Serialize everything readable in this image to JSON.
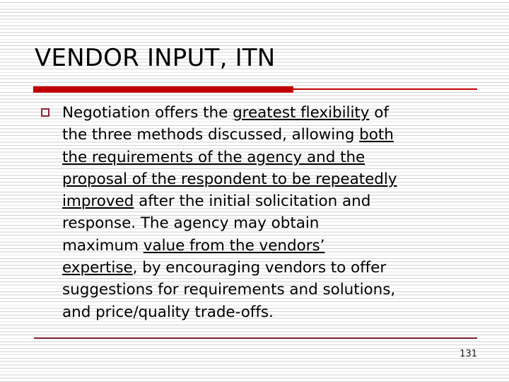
{
  "slide": {
    "title": "VENDOR INPUT, ITN",
    "page_number": "131",
    "colors": {
      "accent_bar": "#c00000",
      "accent_thin_line": "#c00000",
      "bullet_marker": "#8c2233",
      "footer_rule": "#7b2230",
      "text": "#000000",
      "background": "#ffffff",
      "background_stripe": "#d2d2d2"
    },
    "bullet": {
      "marker_icon": "hollow-square-bullet-icon",
      "lines": [
        {
          "segments": [
            {
              "text": "Negotiation offers the ",
              "underline": false
            },
            {
              "text": "greatest flexibility",
              "underline": true
            },
            {
              "text": " of",
              "underline": false
            }
          ]
        },
        {
          "segments": [
            {
              "text": "the three methods discussed, allowing ",
              "underline": false
            },
            {
              "text": "both",
              "underline": true
            }
          ]
        },
        {
          "segments": [
            {
              "text": "the requirements of the agency and the",
              "underline": true
            }
          ]
        },
        {
          "segments": [
            {
              "text": "proposal of the respondent to be repeatedly",
              "underline": true
            }
          ]
        },
        {
          "segments": [
            {
              "text": "improved",
              "underline": true
            },
            {
              "text": " after the initial solicitation and",
              "underline": false
            }
          ]
        },
        {
          "segments": [
            {
              "text": "response.  The agency may obtain",
              "underline": false
            }
          ]
        },
        {
          "segments": [
            {
              "text": "maximum ",
              "underline": false
            },
            {
              "text": "value from the vendors’",
              "underline": true
            }
          ]
        },
        {
          "segments": [
            {
              "text": "expertise",
              "underline": true
            },
            {
              "text": ", by encouraging vendors to offer",
              "underline": false
            }
          ]
        },
        {
          "segments": [
            {
              "text": "suggestions for requirements and solutions,",
              "underline": false
            }
          ]
        },
        {
          "segments": [
            {
              "text": "and price/quality trade-offs.",
              "underline": false
            }
          ]
        }
      ]
    }
  }
}
